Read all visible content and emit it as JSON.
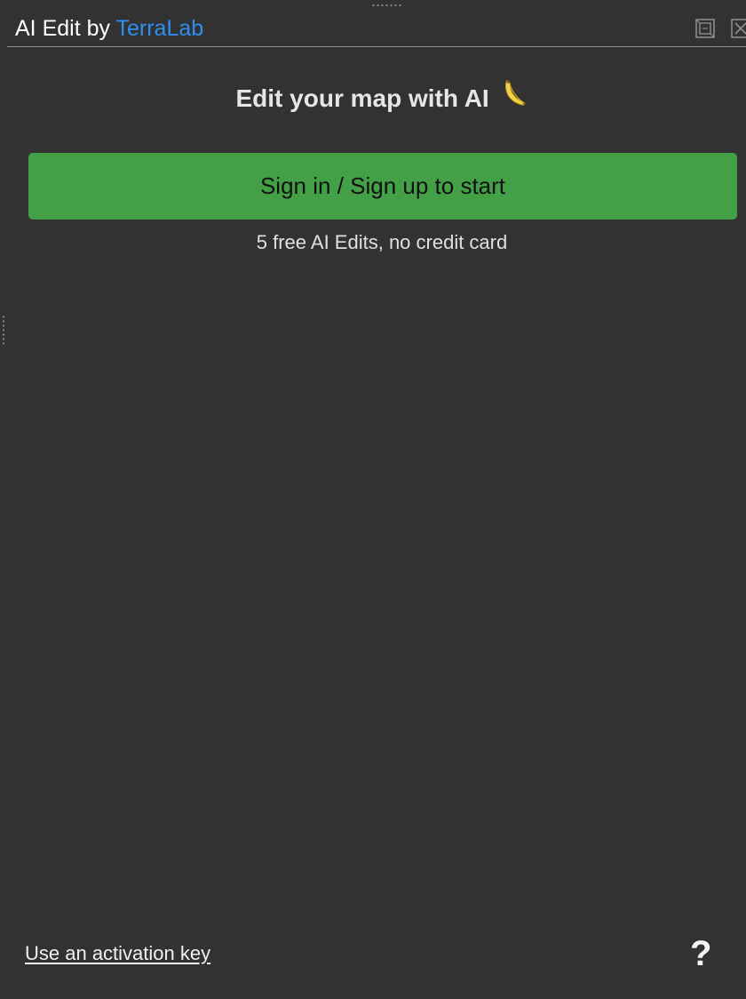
{
  "window": {
    "title_prefix": "AI Edit by",
    "title_brand": "TerraLab",
    "brand_color": "#2f8ff0",
    "float_icon": "float-window-icon",
    "close_icon": "close-icon"
  },
  "main": {
    "heading": "Edit your map with AI",
    "heading_emoji": "banana-icon",
    "signin_label": "Sign in / Sign up to start",
    "signin_color": "#43a047",
    "subtitle": "5 free AI Edits, no credit card"
  },
  "footer": {
    "activation_link": "Use an activation key",
    "help_label": "?",
    "help_icon": "help-icon"
  }
}
